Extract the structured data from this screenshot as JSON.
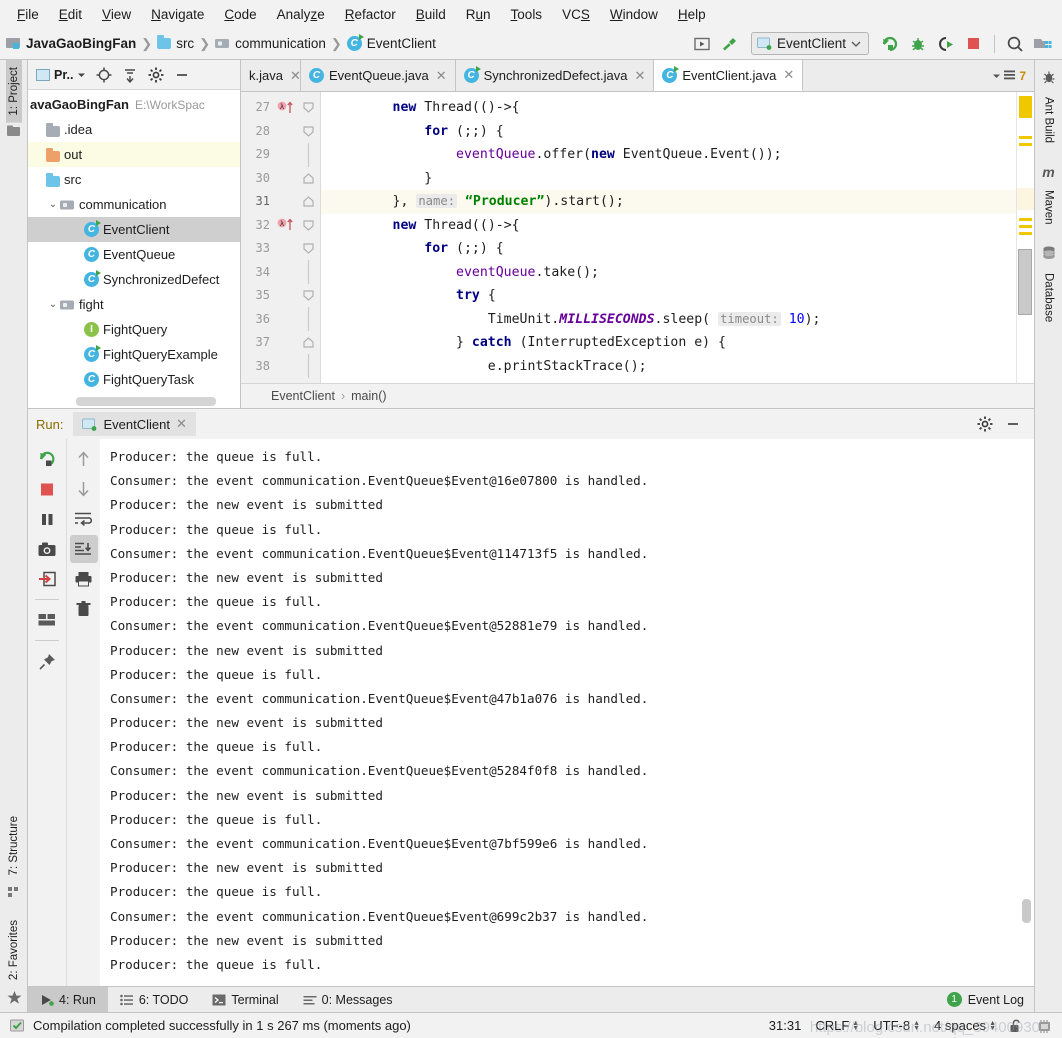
{
  "menu": {
    "items": [
      "File",
      "Edit",
      "View",
      "Navigate",
      "Code",
      "Analyze",
      "Refactor",
      "Build",
      "Run",
      "Tools",
      "VCS",
      "Window",
      "Help"
    ]
  },
  "toolbar": {
    "breadcrumbs": [
      {
        "label": "JavaGaoBingFan",
        "icon": "project-module-icon"
      },
      {
        "label": "src",
        "icon": "source-folder-icon"
      },
      {
        "label": "communication",
        "icon": "package-folder-icon"
      },
      {
        "label": "EventClient",
        "icon": "java-class-icon"
      }
    ],
    "run_config": "EventClient",
    "buttons": [
      "build-button",
      "hammer-build-icon",
      "run-button",
      "debug-button",
      "run-coverage-button",
      "stop-button",
      "search-everywhere-button",
      "project-structure-button"
    ],
    "colors": {
      "run_green": "#3fa34a",
      "stop_red": "#e05252",
      "accent_blue": "#44b5e0"
    }
  },
  "left_strip": {
    "top": [
      {
        "label": "1: Project",
        "icon": "project-folder-icon",
        "selected": true
      }
    ],
    "bottom": [
      {
        "label": "7: Structure",
        "icon": "structure-icon"
      },
      {
        "label": "2: Favorites",
        "icon": "star-icon"
      }
    ]
  },
  "right_strip": {
    "items": [
      {
        "label": "Ant Build",
        "icon": "ant-bug-icon"
      },
      {
        "label": "Maven",
        "icon": "maven-m-icon"
      },
      {
        "label": "Database",
        "icon": "database-icon"
      }
    ]
  },
  "project_panel": {
    "title": "Pr..",
    "toolbar_icons": [
      "locate-target-icon",
      "collapse-all-icon",
      "gear-icon",
      "hide-icon"
    ],
    "tree": [
      {
        "label": "avaGaoBingFan",
        "path": "E:\\WorkSpac",
        "depth": 0,
        "type": "root",
        "state": "none"
      },
      {
        "label": ".idea",
        "depth": 1,
        "type": "folder-grey",
        "state": "none"
      },
      {
        "label": "out",
        "depth": 1,
        "type": "folder-orange",
        "state": "highlight"
      },
      {
        "label": "src",
        "depth": 1,
        "type": "folder-blue",
        "state": "none"
      },
      {
        "label": "communication",
        "depth": 2,
        "type": "package",
        "state": "none",
        "arrow": "expanded"
      },
      {
        "label": "EventClient",
        "depth": 3,
        "type": "class-runnable",
        "state": "selected"
      },
      {
        "label": "EventQueue",
        "depth": 3,
        "type": "class",
        "state": "none"
      },
      {
        "label": "SynchronizedDefect",
        "depth": 3,
        "type": "class-runnable",
        "state": "none"
      },
      {
        "label": "fight",
        "depth": 2,
        "type": "package",
        "state": "none",
        "arrow": "expanded"
      },
      {
        "label": "FightQuery",
        "depth": 3,
        "type": "interface",
        "state": "none"
      },
      {
        "label": "FightQueryExample",
        "depth": 3,
        "type": "class-runnable",
        "state": "none"
      },
      {
        "label": "FightQueryTask",
        "depth": 3,
        "type": "class",
        "state": "none"
      }
    ]
  },
  "editor": {
    "tabs": [
      {
        "label": "k.java",
        "icon": "java-class-icon",
        "active": false,
        "truncated": true
      },
      {
        "label": "EventQueue.java",
        "icon": "java-class-icon",
        "active": false
      },
      {
        "label": "SynchronizedDefect.java",
        "icon": "java-class-runnable-icon",
        "active": false
      },
      {
        "label": "EventClient.java",
        "icon": "java-class-runnable-icon",
        "active": true
      }
    ],
    "tab_count": "7",
    "breadcrumb": [
      "EventClient",
      "main()"
    ],
    "lines": [
      {
        "num": "27",
        "indent": 0,
        "marker": "lambda-arrow",
        "fold": "open",
        "tokens": [
          {
            "t": "        ",
            "c": ""
          },
          {
            "t": "new",
            "c": "kw"
          },
          {
            "t": " Thread(()->{",
            "c": ""
          }
        ]
      },
      {
        "num": "28",
        "indent": 0,
        "fold": "open",
        "tokens": [
          {
            "t": "            ",
            "c": ""
          },
          {
            "t": "for",
            "c": "kw"
          },
          {
            "t": " (;;) {",
            "c": ""
          }
        ]
      },
      {
        "num": "29",
        "indent": 0,
        "tokens": [
          {
            "t": "                ",
            "c": ""
          },
          {
            "t": "eventQueue",
            "c": "fld"
          },
          {
            "t": ".offer(",
            "c": ""
          },
          {
            "t": "new",
            "c": "kw"
          },
          {
            "t": " EventQueue.Event());",
            "c": ""
          }
        ]
      },
      {
        "num": "30",
        "indent": 0,
        "fold": "close",
        "tokens": [
          {
            "t": "            }",
            "c": ""
          }
        ]
      },
      {
        "num": "31",
        "indent": 0,
        "fold": "close",
        "highlight": true,
        "tokens": [
          {
            "t": "        }, ",
            "c": ""
          },
          {
            "t": "name:",
            "c": "hint"
          },
          {
            "t": " ",
            "c": ""
          },
          {
            "t": "“Producer”",
            "c": "str"
          },
          {
            "t": ").start();",
            "c": ""
          }
        ]
      },
      {
        "num": "32",
        "indent": 0,
        "marker": "lambda-arrow",
        "fold": "open",
        "tokens": [
          {
            "t": "        ",
            "c": ""
          },
          {
            "t": "new",
            "c": "kw"
          },
          {
            "t": " Thread(()->{",
            "c": ""
          }
        ]
      },
      {
        "num": "33",
        "indent": 0,
        "fold": "open",
        "tokens": [
          {
            "t": "            ",
            "c": ""
          },
          {
            "t": "for",
            "c": "kw"
          },
          {
            "t": " (;;) {",
            "c": ""
          }
        ]
      },
      {
        "num": "34",
        "indent": 0,
        "tokens": [
          {
            "t": "                ",
            "c": ""
          },
          {
            "t": "eventQueue",
            "c": "fld"
          },
          {
            "t": ".take();",
            "c": ""
          }
        ]
      },
      {
        "num": "35",
        "indent": 0,
        "fold": "open",
        "tokens": [
          {
            "t": "                ",
            "c": ""
          },
          {
            "t": "try",
            "c": "kw"
          },
          {
            "t": " {",
            "c": ""
          }
        ]
      },
      {
        "num": "36",
        "indent": 0,
        "tokens": [
          {
            "t": "                    TimeUnit.",
            "c": ""
          },
          {
            "t": "MILLISECONDS",
            "c": "stat"
          },
          {
            "t": ".sleep( ",
            "c": ""
          },
          {
            "t": "timeout:",
            "c": "hint"
          },
          {
            "t": " ",
            "c": ""
          },
          {
            "t": "10",
            "c": "num"
          },
          {
            "t": ");",
            "c": ""
          }
        ]
      },
      {
        "num": "37",
        "indent": 0,
        "fold": "close",
        "tokens": [
          {
            "t": "                } ",
            "c": ""
          },
          {
            "t": "catch",
            "c": "kw"
          },
          {
            "t": " (InterruptedException e) {",
            "c": ""
          }
        ]
      },
      {
        "num": "38",
        "indent": 0,
        "tokens": [
          {
            "t": "                    e.printStackTrace();",
            "c": ""
          }
        ]
      }
    ]
  },
  "run_panel": {
    "label": "Run:",
    "tab": "EventClient",
    "left_tools": [
      "rerun-icon",
      "stop-icon",
      "pause-icon",
      "camera-icon",
      "export-icon",
      "layout-icon",
      "pin-icon"
    ],
    "right_tools": [
      "arrow-up-icon",
      "arrow-down-icon",
      "soft-wrap-icon",
      "scroll-to-end-icon",
      "print-icon",
      "trash-icon"
    ],
    "head_buttons": [
      "gear-icon",
      "minimize-icon"
    ],
    "console": [
      "Producer: the queue is full.",
      "Consumer: the event communication.EventQueue$Event@16e07800 is handled.",
      "Producer: the new event is submitted",
      "Producer: the queue is full.",
      "Consumer: the event communication.EventQueue$Event@114713f5 is handled.",
      "Producer: the new event is submitted",
      "Producer: the queue is full.",
      "Consumer: the event communication.EventQueue$Event@52881e79 is handled.",
      "Producer: the new event is submitted",
      "Producer: the queue is full.",
      "Consumer: the event communication.EventQueue$Event@47b1a076 is handled.",
      "Producer: the new event is submitted",
      "Producer: the queue is full.",
      "Consumer: the event communication.EventQueue$Event@5284f0f8 is handled.",
      "Producer: the new event is submitted",
      "Producer: the queue is full.",
      "Consumer: the event communication.EventQueue$Event@7bf599e6 is handled.",
      "Producer: the new event is submitted",
      "Producer: the queue is full.",
      "Consumer: the event communication.EventQueue$Event@699c2b37 is handled.",
      "Producer: the new event is submitted",
      "Producer: the queue is full."
    ]
  },
  "bottom_bar": {
    "items": [
      {
        "label": "4: Run",
        "icon": "run-icon",
        "selected": true
      },
      {
        "label": "6: TODO",
        "icon": "todo-list-icon",
        "selected": false
      },
      {
        "label": "Terminal",
        "icon": "terminal-icon",
        "selected": false
      },
      {
        "label": "0: Messages",
        "icon": "messages-icon",
        "selected": false
      }
    ],
    "event_log": "Event Log",
    "event_log_count": "1"
  },
  "status_bar": {
    "message": "Compilation completed successfully in 1 s 267 ms (moments ago)",
    "caret": "31:31",
    "line_sep": "CRLF",
    "encoding": "UTF-8",
    "indent": "4 spaces",
    "lock_icon": "unlocked-icon",
    "watermark": "https://blog.csdn.net/qq_39400930"
  }
}
